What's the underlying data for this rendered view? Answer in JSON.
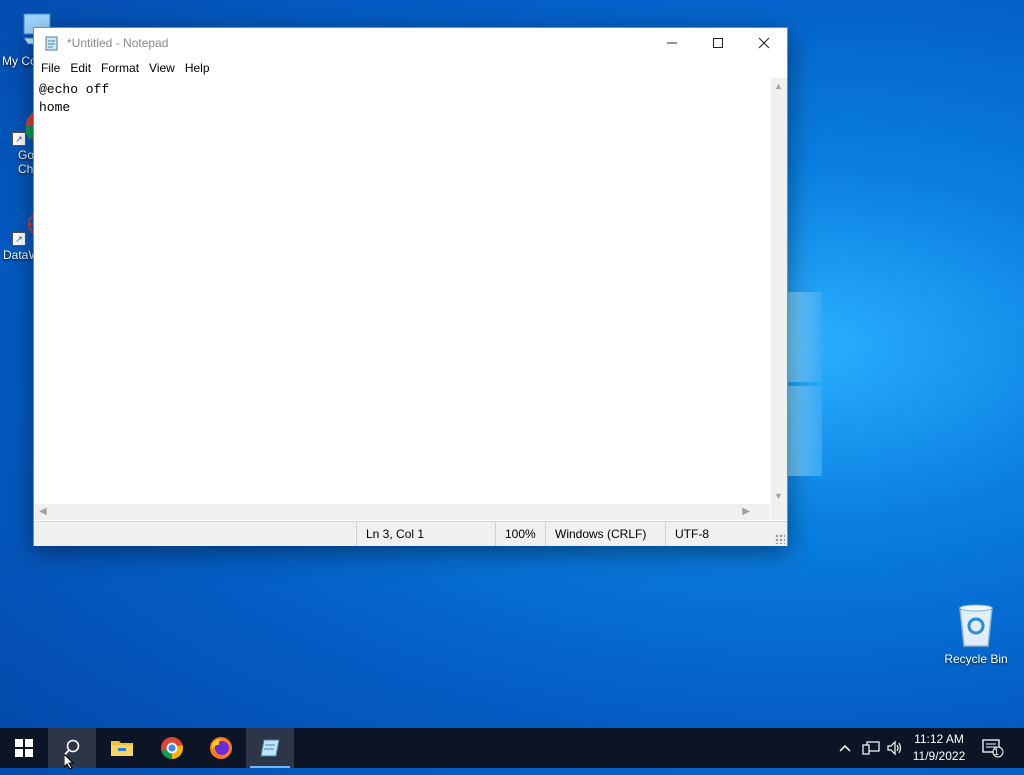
{
  "desktop": {
    "icons": [
      {
        "label": "My Co"
      },
      {
        "label_line1": "Go",
        "label_line2": "Ch"
      },
      {
        "label": "DataW"
      }
    ],
    "recycle_bin": {
      "label": "Recycle Bin"
    }
  },
  "window": {
    "title": "*Untitled - Notepad",
    "controls": {
      "minimize": "—",
      "maximize": "☐",
      "close": "✕"
    }
  },
  "menu": {
    "items": [
      "File",
      "Edit",
      "Format",
      "View",
      "Help"
    ]
  },
  "editor": {
    "content": "@echo off\nhome"
  },
  "status": {
    "position": "Ln 3, Col 1",
    "zoom": "100%",
    "line_ending": "Windows (CRLF)",
    "encoding": "UTF-8"
  },
  "taskbar": {
    "apps": [
      "start-icon",
      "search-icon",
      "file-explorer-icon",
      "chrome-icon",
      "firefox-icon",
      "notepad-icon"
    ],
    "clock": {
      "time": "11:12 AM",
      "date": "11/9/2022"
    },
    "notifications_count": "1"
  },
  "colors": {
    "taskbar_bg": "#0b1526",
    "desktop_accent": "#0a7fe0"
  }
}
